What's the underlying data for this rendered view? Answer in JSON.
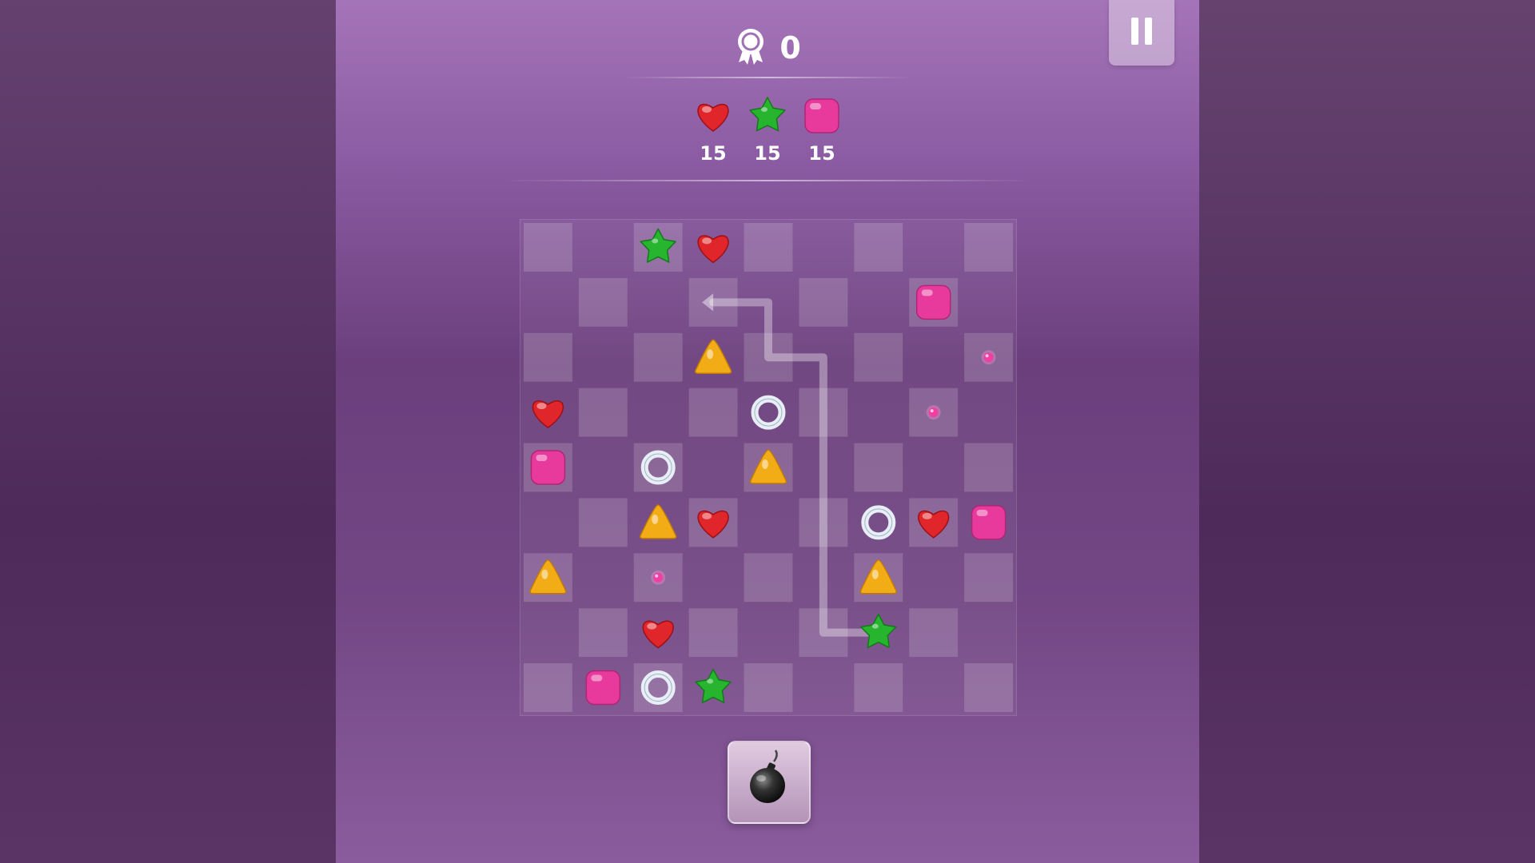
{
  "score": {
    "icon": "medal-icon",
    "value": "0"
  },
  "pause": {
    "icon": "pause-icon"
  },
  "goals": [
    {
      "piece": "heart",
      "icon": "red-heart-icon",
      "count": "15"
    },
    {
      "piece": "star",
      "icon": "green-star-icon",
      "count": "15"
    },
    {
      "piece": "square",
      "icon": "pink-square-icon",
      "count": "15"
    }
  ],
  "board": {
    "rows": 9,
    "cols": 9,
    "pieces": [
      {
        "row": 0,
        "col": 2,
        "type": "star"
      },
      {
        "row": 0,
        "col": 3,
        "type": "heart"
      },
      {
        "row": 1,
        "col": 7,
        "type": "square"
      },
      {
        "row": 2,
        "col": 3,
        "type": "triangle"
      },
      {
        "row": 2,
        "col": 8,
        "type": "dot"
      },
      {
        "row": 3,
        "col": 0,
        "type": "heart"
      },
      {
        "row": 3,
        "col": 4,
        "type": "ring"
      },
      {
        "row": 3,
        "col": 7,
        "type": "dot"
      },
      {
        "row": 4,
        "col": 0,
        "type": "square"
      },
      {
        "row": 4,
        "col": 2,
        "type": "ring"
      },
      {
        "row": 4,
        "col": 4,
        "type": "triangle"
      },
      {
        "row": 5,
        "col": 2,
        "type": "triangle"
      },
      {
        "row": 5,
        "col": 3,
        "type": "heart"
      },
      {
        "row": 5,
        "col": 6,
        "type": "ring"
      },
      {
        "row": 5,
        "col": 7,
        "type": "heart"
      },
      {
        "row": 5,
        "col": 8,
        "type": "square"
      },
      {
        "row": 6,
        "col": 0,
        "type": "triangle"
      },
      {
        "row": 6,
        "col": 2,
        "type": "dot"
      },
      {
        "row": 6,
        "col": 6,
        "type": "triangle"
      },
      {
        "row": 7,
        "col": 2,
        "type": "heart"
      },
      {
        "row": 7,
        "col": 6,
        "type": "star"
      },
      {
        "row": 8,
        "col": 1,
        "type": "square"
      },
      {
        "row": 8,
        "col": 2,
        "type": "ring"
      },
      {
        "row": 8,
        "col": 3,
        "type": "star"
      }
    ],
    "hint_path": [
      [
        7,
        6
      ],
      [
        7,
        5
      ],
      [
        2,
        5
      ],
      [
        2,
        4
      ],
      [
        1,
        4
      ],
      [
        1,
        3
      ]
    ]
  },
  "powerup": {
    "icon": "bomb-icon"
  },
  "colors": {
    "heart": "#e0262b",
    "star": "#27b530",
    "square": "#e83a9d",
    "triangle": "#f2ad16",
    "ring": "#e8eef5",
    "dot": "#f03fa3"
  }
}
